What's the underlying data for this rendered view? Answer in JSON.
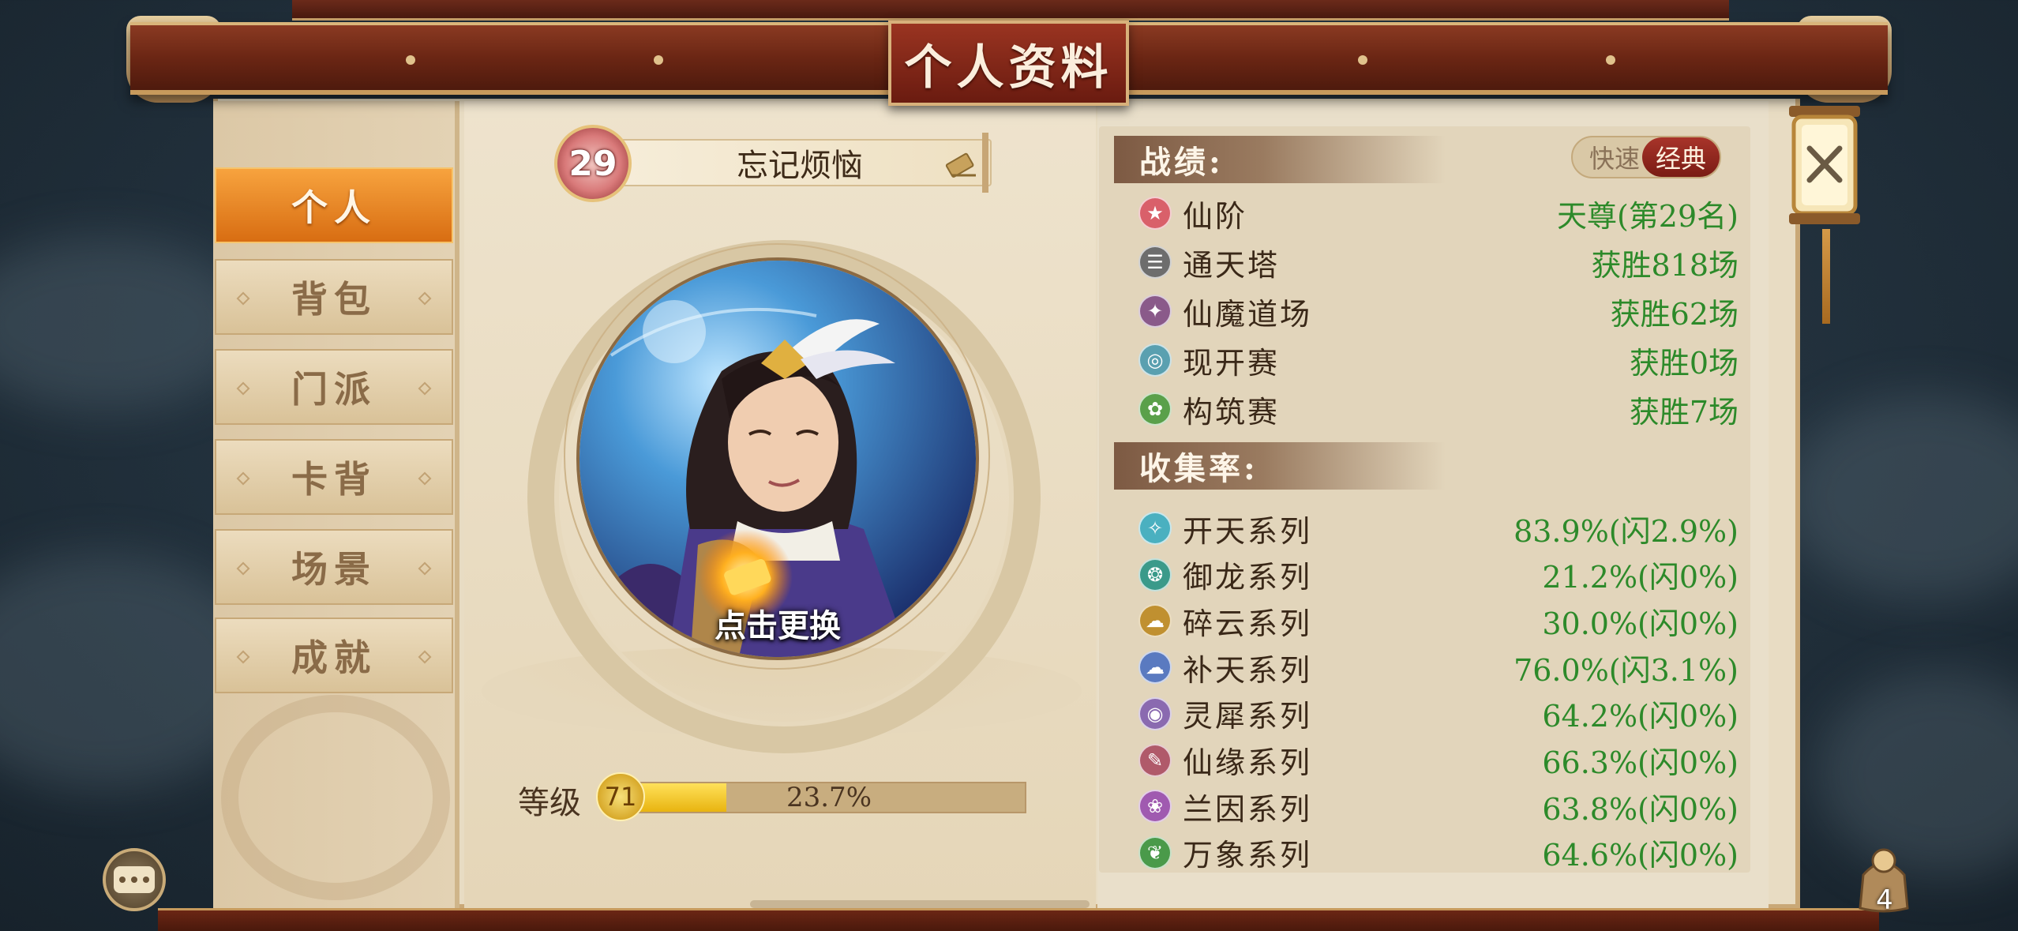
{
  "header": {
    "title": "个人资料"
  },
  "sidebar": {
    "items": [
      {
        "label": "个人",
        "active": true
      },
      {
        "label": "背包",
        "active": false
      },
      {
        "label": "门派",
        "active": false
      },
      {
        "label": "卡背",
        "active": false
      },
      {
        "label": "场景",
        "active": false
      },
      {
        "label": "成就",
        "active": false
      }
    ]
  },
  "profile": {
    "level_badge": "29",
    "player_name": "忘记烦恼",
    "avatar_caption": "点击更换",
    "grade_label": "等级",
    "grade_value": "71",
    "grade_progress_text": "23.7%",
    "grade_progress": 0.237
  },
  "stats": {
    "record_title": "战绩:",
    "mode_fast": "快速",
    "mode_classic": "经典",
    "records": [
      {
        "icon": "star-icon",
        "color": "#d9606a",
        "glyph": "★",
        "label": "仙阶",
        "value": "天尊(第29名)"
      },
      {
        "icon": "tower-icon",
        "color": "#6d6d6d",
        "glyph": "☰",
        "label": "通天塔",
        "value": "获胜818场"
      },
      {
        "icon": "demon-arena-icon",
        "color": "#8a5a8a",
        "glyph": "✦",
        "label": "仙魔道场",
        "value": "获胜62场"
      },
      {
        "icon": "open-match-icon",
        "color": "#5aa0b0",
        "glyph": "◎",
        "label": "现开赛",
        "value": "获胜0场"
      },
      {
        "icon": "build-match-icon",
        "color": "#5aa04a",
        "glyph": "✿",
        "label": "构筑赛",
        "value": "获胜7场"
      }
    ],
    "collection_title": "收集率:",
    "collections": [
      {
        "icon": "kaitian-icon",
        "color": "#4ab0c0",
        "glyph": "✧",
        "label": "开天系列",
        "value": "83.9%(闪2.9%)"
      },
      {
        "icon": "yulong-icon",
        "color": "#3a9a8a",
        "glyph": "❂",
        "label": "御龙系列",
        "value": "21.2%(闪0%)"
      },
      {
        "icon": "suiyun-icon",
        "color": "#c09030",
        "glyph": "☁",
        "label": "碎云系列",
        "value": "30.0%(闪0%)"
      },
      {
        "icon": "butian-icon",
        "color": "#5a7ac0",
        "glyph": "☁",
        "label": "补天系列",
        "value": "76.0%(闪3.1%)"
      },
      {
        "icon": "lingxi-icon",
        "color": "#8a6ab0",
        "glyph": "◉",
        "label": "灵犀系列",
        "value": "64.2%(闪0%)"
      },
      {
        "icon": "xianyuan-icon",
        "color": "#b05a6a",
        "glyph": "✎",
        "label": "仙缘系列",
        "value": "66.3%(闪0%)"
      },
      {
        "icon": "lanyin-icon",
        "color": "#a05ab0",
        "glyph": "❀",
        "label": "兰因系列",
        "value": "63.8%(闪0%)"
      },
      {
        "icon": "wanxiang-icon",
        "color": "#4a9a4a",
        "glyph": "❦",
        "label": "万象系列",
        "value": "64.6%(闪0%)"
      }
    ]
  },
  "bag_count": "4"
}
